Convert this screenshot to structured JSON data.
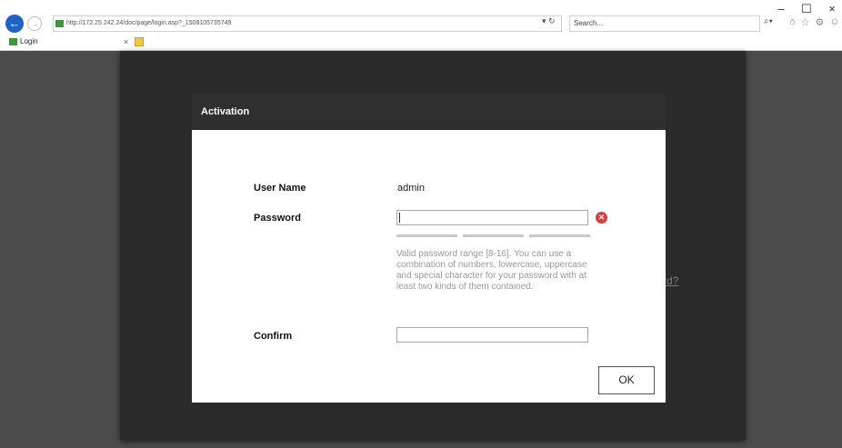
{
  "browser": {
    "url": "http://172.25.242.24/doc/page/login.asp?_1508105735749",
    "search_placeholder": "Search...",
    "tab_title": "Login",
    "tab_close": "×",
    "back_glyph": "←",
    "forward_glyph": "→",
    "addr_tools": "▾ ↻",
    "search_glyph": "⌕▾",
    "icons": {
      "home": "⌂",
      "star": "☆",
      "gear": "⚙",
      "smile": "☺"
    },
    "window_controls": {
      "minimize": "–",
      "maximize": "☐",
      "close": "×"
    }
  },
  "background": {
    "link_fragment": "rd?"
  },
  "dialog": {
    "title": "Activation",
    "username_label": "User Name",
    "username_value": "admin",
    "password_label": "Password",
    "password_value": "",
    "error_glyph": "✕",
    "strength_segments": 3,
    "hint": "Valid password range [8-16]. You can use a combination of numbers, lowercase, uppercase and special character for your password with at least two kinds of them contained.",
    "confirm_label": "Confirm",
    "confirm_value": "",
    "ok_label": "OK"
  },
  "colors": {
    "dialog_header": "#2f2f2f",
    "page_background": "#4b4b4b",
    "error_icon": "#e03a3a",
    "back_button": "#1e64c8"
  }
}
